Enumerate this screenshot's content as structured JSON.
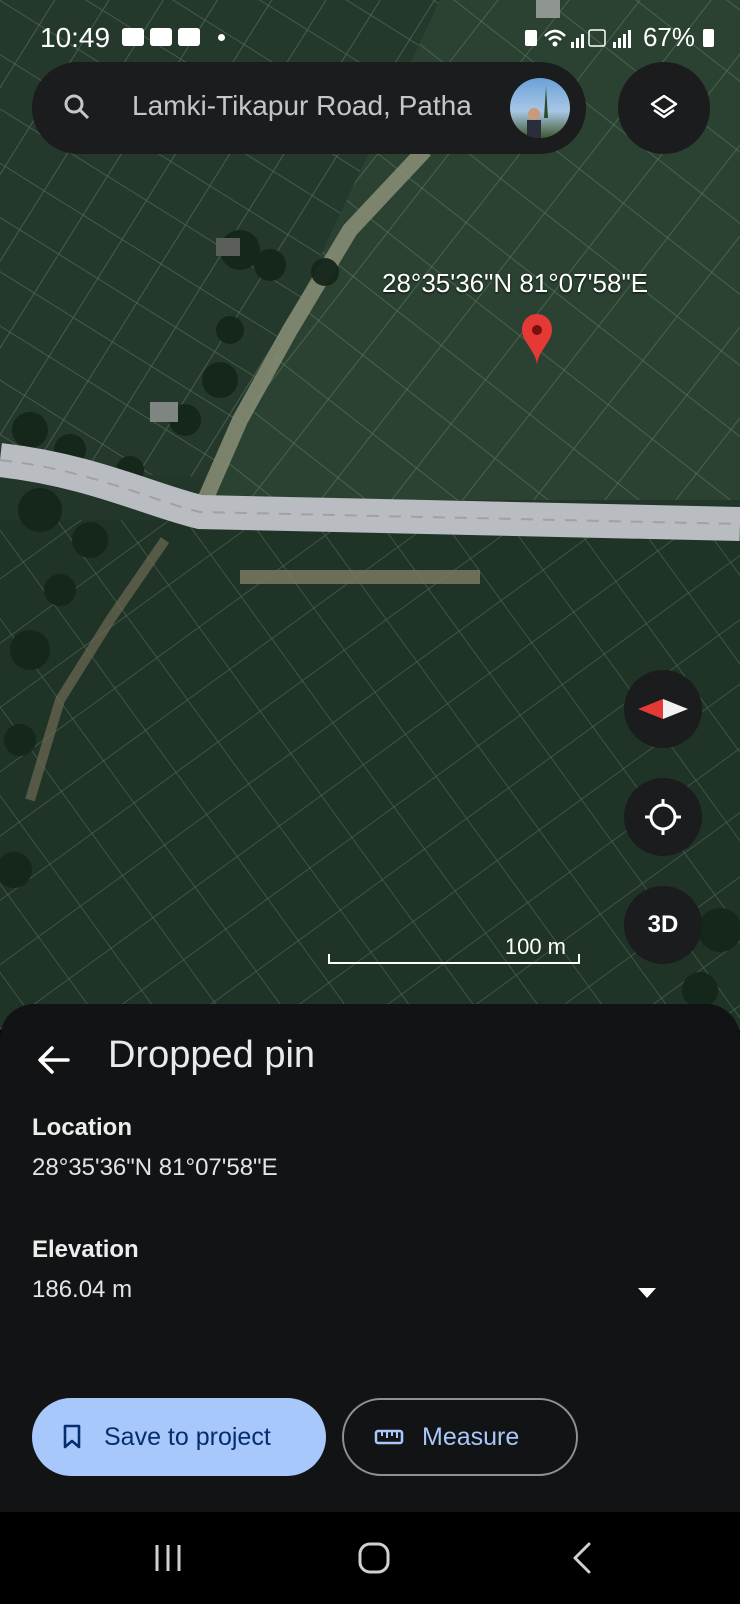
{
  "status_bar": {
    "time": "10:49",
    "battery": "67%"
  },
  "search": {
    "value": "Lamki-Tikapur Road, Patha"
  },
  "map": {
    "pin_coordinates": "28°35'36\"N 81°07'58\"E",
    "scale_label": "100 m",
    "three_d_label": "3D"
  },
  "sheet": {
    "title": "Dropped pin",
    "location_label": "Location",
    "location_value": "28°35'36\"N 81°07'58\"E",
    "elevation_label": "Elevation",
    "elevation_value": "186.04 m",
    "save_label": "Save to project",
    "measure_label": "Measure"
  },
  "icons": {
    "search": "search-icon",
    "layers": "layers-icon",
    "pin": "map-pin-icon",
    "compass": "compass-icon",
    "locate": "my-location-icon",
    "back": "back-arrow-icon",
    "bookmark": "bookmark-icon",
    "ruler": "ruler-icon"
  },
  "colors": {
    "accent": "#a8c7fa",
    "pin": "#e53935",
    "sheet_bg": "#121314"
  }
}
